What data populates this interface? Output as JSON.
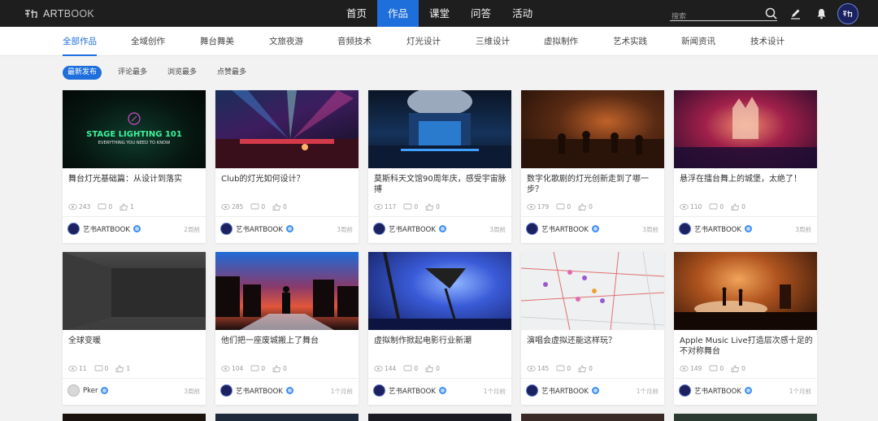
{
  "header": {
    "logo": {
      "prefix": "ART",
      "suffix": "BOOK"
    },
    "nav": [
      "首页",
      "作品",
      "课堂",
      "问答",
      "活动"
    ],
    "active_nav": 1,
    "search_placeholder": "搜索",
    "icons": [
      "search-icon",
      "edit-icon",
      "bell-icon"
    ]
  },
  "categories": [
    "全部作品",
    "全域创作",
    "舞台舞美",
    "文旅夜游",
    "音频技术",
    "灯光设计",
    "三维设计",
    "虚拟制作",
    "艺术实践",
    "新闻资讯",
    "技术设计"
  ],
  "active_category": 0,
  "sort": [
    "最新发布",
    "评论最多",
    "浏览最多",
    "点赞最多"
  ],
  "active_sort": 0,
  "colors": {
    "accent": "#1e6fdc",
    "topbar": "#1e1e1e",
    "background": "#f2f2f2"
  },
  "cards": [
    {
      "title": "舞台灯光基础篇：从设计到落实",
      "views": "243",
      "comments": "0",
      "likes": "1",
      "author": "艺书ARTBOOK",
      "time": "2周前",
      "thumb_text_1": "STAGE LIGHTING 101",
      "thumb_text_2": "EVERYTHING YOU NEED TO KNOW"
    },
    {
      "title": "Club的灯光如何设计？",
      "views": "285",
      "comments": "0",
      "likes": "0",
      "author": "艺书ARTBOOK",
      "time": "3周前"
    },
    {
      "title": "莫斯科天文馆90周年庆，感受宇宙脉搏",
      "views": "117",
      "comments": "0",
      "likes": "0",
      "author": "艺书ARTBOOK",
      "time": "3周前"
    },
    {
      "title": "数字化歌剧的灯光创新走到了哪一步？",
      "views": "179",
      "comments": "0",
      "likes": "0",
      "author": "艺书ARTBOOK",
      "time": "3周前"
    },
    {
      "title": "悬浮在擂台舞上的城堡，太绝了！",
      "views": "110",
      "comments": "0",
      "likes": "0",
      "author": "艺书ARTBOOK",
      "time": "3周前"
    },
    {
      "title": "全球变暖",
      "views": "11",
      "comments": "0",
      "likes": "1",
      "author": "Pker",
      "time": "3周前"
    },
    {
      "title": "他们把一座废城搬上了舞台",
      "views": "104",
      "comments": "0",
      "likes": "0",
      "author": "艺书ARTBOOK",
      "time": "1个月前"
    },
    {
      "title": "虚拟制作掀起电影行业新潮",
      "views": "144",
      "comments": "0",
      "likes": "0",
      "author": "艺书ARTBOOK",
      "time": "1个月前"
    },
    {
      "title": "演唱会虚拟还能这样玩？",
      "views": "145",
      "comments": "0",
      "likes": "0",
      "author": "艺书ARTBOOK",
      "time": "1个月前"
    },
    {
      "title": "Apple Music Live打造层次感十足的不对称舞台",
      "views": "149",
      "comments": "0",
      "likes": "0",
      "author": "艺书ARTBOOK",
      "time": "1个月前"
    }
  ]
}
